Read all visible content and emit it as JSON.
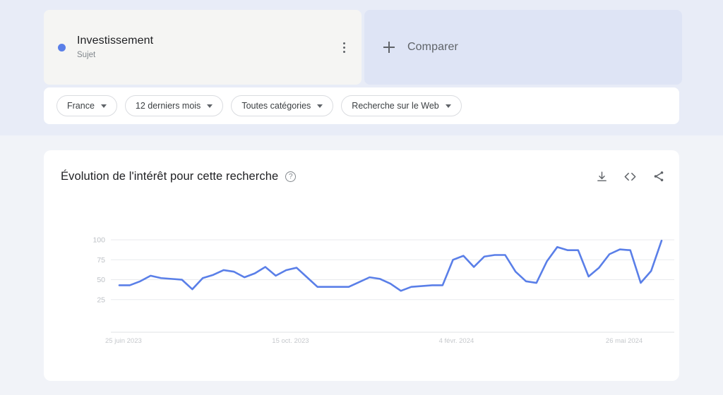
{
  "theme": {
    "band_top": "#e8ecf7",
    "band_bottom": "#f1f3f8",
    "card_bg": "#ffffff",
    "term_card_bg": "#f5f5f3",
    "compare_card_bg": "#dee4f5",
    "series_color": "#5a7fe8",
    "grid_color": "#e8eaed"
  },
  "terms": [
    {
      "dot_color": "#5a7fe8",
      "title": "Investissement",
      "subtitle": "Sujet",
      "menu_icon": "kebab-menu-icon"
    }
  ],
  "compare": {
    "label": "Comparer",
    "icon": "plus-icon"
  },
  "filters": [
    {
      "label": "France",
      "icon": "chevron-down-icon"
    },
    {
      "label": "12 derniers mois",
      "icon": "chevron-down-icon"
    },
    {
      "label": "Toutes catégories",
      "icon": "chevron-down-icon"
    },
    {
      "label": "Recherche sur le Web",
      "icon": "chevron-down-icon"
    }
  ],
  "chart_card": {
    "title": "Évolution de l'intérêt pour cette recherche",
    "help_icon": "help-circle-icon",
    "help_glyph": "?",
    "actions": [
      {
        "name": "download-icon",
        "tooltip": "Télécharger"
      },
      {
        "name": "embed-code-icon",
        "tooltip": "Code d'intégration"
      },
      {
        "name": "share-icon",
        "tooltip": "Partager"
      }
    ]
  },
  "chart_data": {
    "type": "line",
    "title": "Évolution de l'intérêt pour cette recherche",
    "xlabel": "",
    "ylabel": "",
    "ylim": [
      0,
      108
    ],
    "yticks": [
      25,
      50,
      75,
      100
    ],
    "ytick_labels": [
      "25",
      "50",
      "75",
      "100"
    ],
    "grid": true,
    "legend": false,
    "series_name": "Investissement",
    "series_color": "#5a7fe8",
    "x_tick_labels": [
      "25 juin 2023",
      "15 oct. 2023",
      "4 févr. 2024",
      "26 mai 2024"
    ],
    "x_tick_indices": [
      0,
      16,
      32,
      48
    ],
    "n_points": 53,
    "values": [
      43,
      43,
      48,
      55,
      52,
      51,
      50,
      38,
      52,
      56,
      62,
      60,
      53,
      58,
      66,
      55,
      62,
      65,
      53,
      41,
      41,
      41,
      41,
      47,
      53,
      51,
      45,
      36,
      41,
      42,
      43,
      43,
      75,
      80,
      66,
      79,
      81,
      81,
      60,
      48,
      46,
      73,
      91,
      87,
      87,
      54,
      65,
      82,
      88,
      87,
      46,
      61,
      99
    ]
  }
}
